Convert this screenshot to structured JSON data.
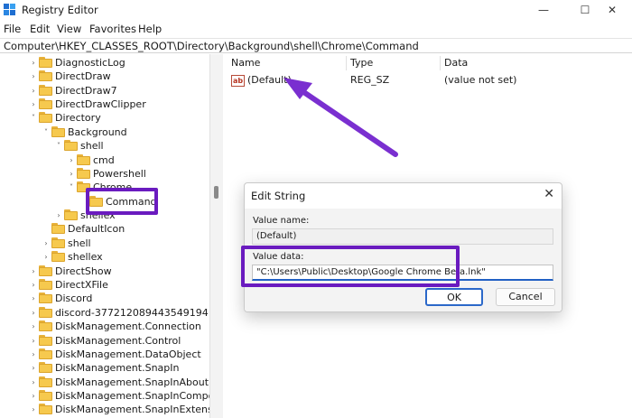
{
  "window": {
    "title": "Registry Editor",
    "minimize_glyph": "—",
    "maximize_glyph": "☐",
    "close_glyph": "✕"
  },
  "menu": [
    "File",
    "Edit",
    "View",
    "Favorites",
    "Help"
  ],
  "address": "Computer\\HKEY_CLASSES_ROOT\\Directory\\Background\\shell\\Chrome\\Command",
  "tree": [
    {
      "label": "DiagnosticLog",
      "chevron": "›"
    },
    {
      "label": "DirectDraw",
      "chevron": "›"
    },
    {
      "label": "DirectDraw7",
      "chevron": "›"
    },
    {
      "label": "DirectDrawClipper",
      "chevron": "›"
    },
    {
      "label": "Directory",
      "chevron": "˅"
    },
    {
      "label": "Background",
      "chevron": "˅"
    },
    {
      "label": "shell",
      "chevron": "˅"
    },
    {
      "label": "cmd",
      "chevron": "›"
    },
    {
      "label": "Powershell",
      "chevron": "›"
    },
    {
      "label": "Chrome",
      "chevron": "˅"
    },
    {
      "label": "Command",
      "chevron": ""
    },
    {
      "label": "shellex",
      "chevron": "›"
    },
    {
      "label": "DefaultIcon",
      "chevron": ""
    },
    {
      "label": "shell",
      "chevron": "›"
    },
    {
      "label": "shellex",
      "chevron": "›"
    },
    {
      "label": "DirectShow",
      "chevron": "›"
    },
    {
      "label": "DirectXFile",
      "chevron": "›"
    },
    {
      "label": "Discord",
      "chevron": "›"
    },
    {
      "label": "discord-377212089443549194",
      "chevron": "›"
    },
    {
      "label": "DiskManagement.Connection",
      "chevron": "›"
    },
    {
      "label": "DiskManagement.Control",
      "chevron": "›"
    },
    {
      "label": "DiskManagement.DataObject",
      "chevron": "›"
    },
    {
      "label": "DiskManagement.SnapIn",
      "chevron": "›"
    },
    {
      "label": "DiskManagement.SnapInAbout",
      "chevron": "›"
    },
    {
      "label": "DiskManagement.SnapInComponent",
      "chevron": "›"
    },
    {
      "label": "DiskManagement.SnapInExtension",
      "chevron": "›"
    }
  ],
  "list": {
    "headers": {
      "name": "Name",
      "type": "Type",
      "data": "Data"
    },
    "rows": [
      {
        "icon": "ab",
        "name": "(Default)",
        "type": "REG_SZ",
        "data": "(value not set)"
      }
    ]
  },
  "dialog": {
    "title": "Edit String",
    "close_glyph": "✕",
    "value_name_label": "Value name:",
    "value_name": "(Default)",
    "value_data_label": "Value data:",
    "value_data": "\"C:\\Users\\Public\\Desktop\\Google Chrome Beta.lnk\"",
    "ok_label": "OK",
    "cancel_label": "Cancel"
  },
  "colors": {
    "highlight": "#6a1bbf",
    "arrow": "#7a2fd0",
    "accent": "#2160c4"
  }
}
